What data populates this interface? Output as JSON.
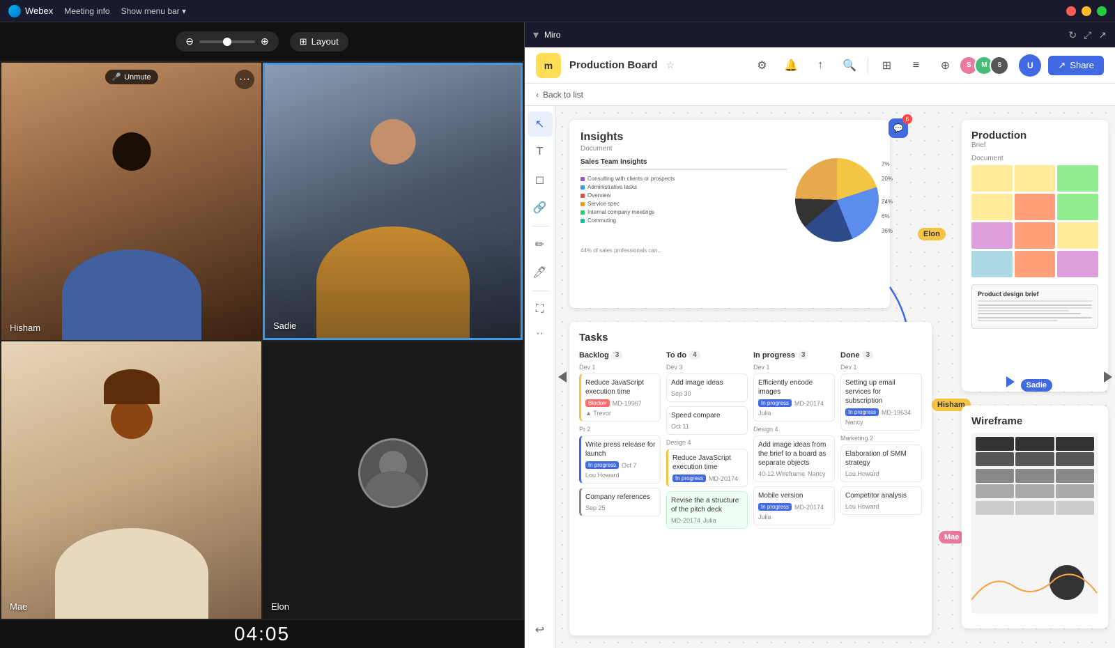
{
  "titlebar": {
    "app_name": "Webex",
    "meeting_info": "Meeting info",
    "show_menu": "Show menu bar"
  },
  "video_controls": {
    "layout_btn": "Layout"
  },
  "participants": [
    {
      "name": "Hisham",
      "position": "top-left",
      "has_unmute": true
    },
    {
      "name": "Sadie",
      "position": "top-right",
      "active_speaker": true
    },
    {
      "name": "Mae",
      "position": "bottom-left"
    },
    {
      "name": "Elon",
      "position": "bottom-right"
    }
  ],
  "unmute_btn": "Unmute",
  "miro": {
    "logo": "miro",
    "app_title": "Miro",
    "back_label": "Back to list",
    "board_title": "Production Board",
    "share_btn": "Share",
    "avatar_count": "8",
    "insights_section": {
      "title": "Insights",
      "subtitle": "Document"
    },
    "tasks_section": {
      "title": "Tasks",
      "columns": [
        {
          "name": "Backlog",
          "count": "3"
        },
        {
          "name": "To do",
          "count": "4"
        },
        {
          "name": "In progress",
          "count": "3"
        },
        {
          "name": "Done",
          "count": "3"
        }
      ]
    },
    "production_section": {
      "title": "Production",
      "subtitle": "Brief",
      "doc_label": "Document",
      "inner_title": "Product design brief"
    },
    "wireframe_section": {
      "title": "Wireframe"
    }
  },
  "cursors": {
    "elon": "Elon",
    "hisham": "Hisham",
    "sadie": "Sadie",
    "mae": "Mae"
  },
  "time": "04:05",
  "tools": [
    "cursor",
    "text",
    "sticky",
    "link",
    "pen",
    "marker",
    "crop",
    "more"
  ],
  "comment_count": "6"
}
